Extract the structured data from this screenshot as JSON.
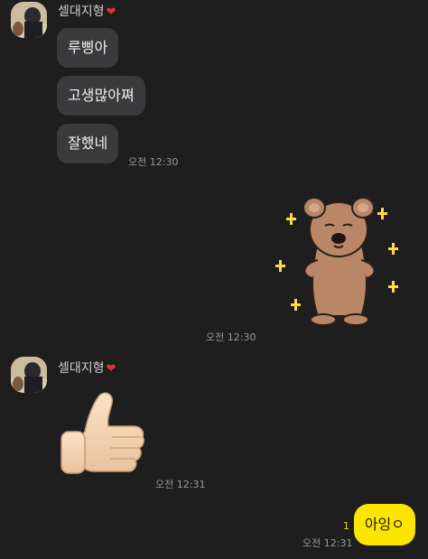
{
  "thread": {
    "sender_name": "셀대지형",
    "group1": {
      "messages": [
        "루삥아",
        "고생많아쪄",
        "잘했네"
      ],
      "time": "오전 12:30"
    },
    "sticker": {
      "name": "quokka-sticker",
      "time": "오전 12:30"
    },
    "group2": {
      "emoji": "👍",
      "time": "오전 12:31"
    },
    "mine": {
      "text": "아잉ㅇ",
      "unread_count": "1",
      "time": "오전 12:31"
    }
  },
  "colors": {
    "background": "#1e1e1e",
    "received_bubble": "#3a3a3c",
    "sent_bubble": "#fee500",
    "heart": "#e0323c",
    "unread": "#f5d32c",
    "sparkle": "#ffd84a",
    "quokka": "#b98667"
  }
}
